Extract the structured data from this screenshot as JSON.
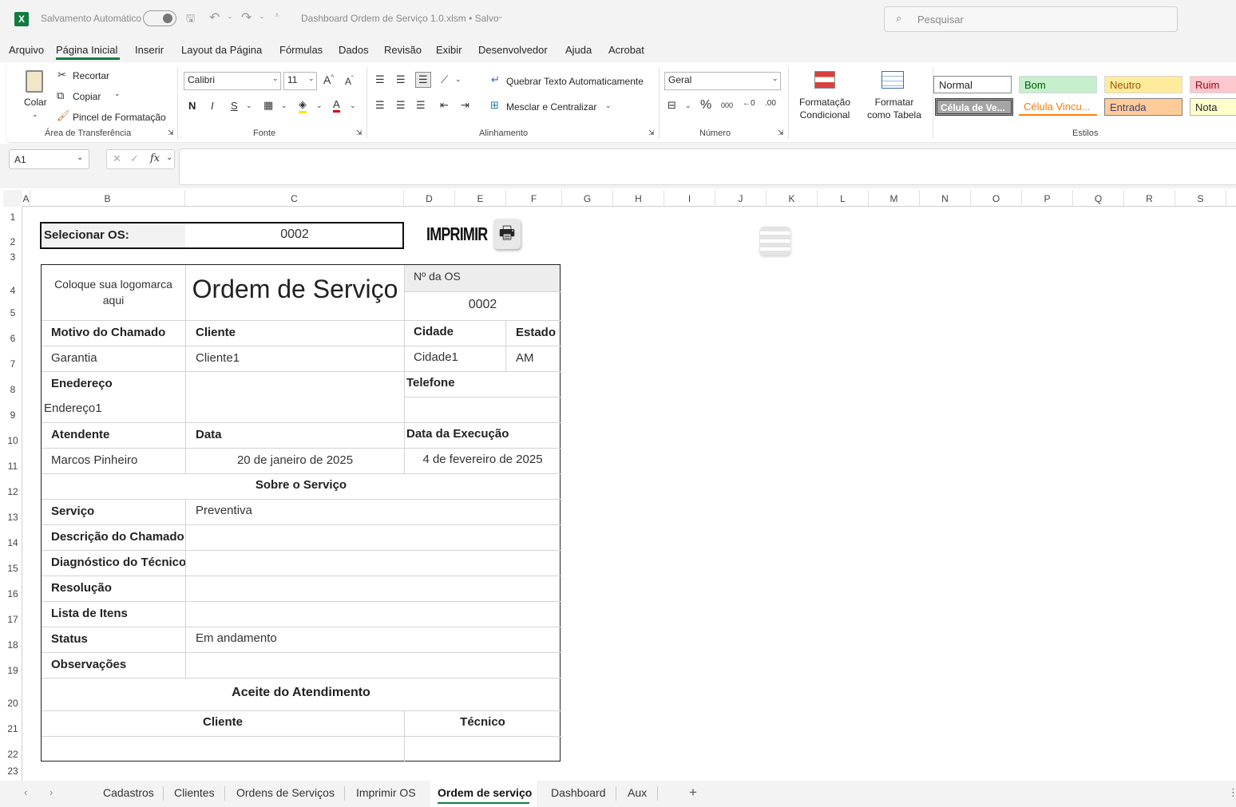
{
  "titlebar": {
    "autosave": "Salvamento Automático",
    "toggle": "Desativado",
    "filename": "Dashboard Ordem de Serviço 1.0.xlsm • Salvo",
    "search_placeholder": "Pesquisar"
  },
  "menu": [
    "Arquivo",
    "Página Inicial",
    "Inserir",
    "Layout da Página",
    "Fórmulas",
    "Dados",
    "Revisão",
    "Exibir",
    "Desenvolvedor",
    "Ajuda",
    "Acrobat"
  ],
  "ribbon": {
    "clipboard": {
      "paste": "Colar",
      "cut": "Recortar",
      "copy": "Copiar",
      "format_painter": "Pincel de Formatação",
      "group": "Área de Transferência"
    },
    "font": {
      "name": "Calibri",
      "size": "11",
      "bold": "N",
      "italic": "I",
      "underline": "S",
      "group": "Fonte"
    },
    "alignment": {
      "wrap": "Quebrar Texto Automaticamente",
      "merge": "Mesclar e Centralizar",
      "group": "Alinhamento"
    },
    "number": {
      "format": "Geral",
      "group": "Número"
    },
    "conditional": "Formatação Condicional",
    "format_table": "Formatar como Tabela",
    "styles": {
      "group": "Estilos",
      "normal": "Normal",
      "bom": "Bom",
      "neutro": "Neutro",
      "ruim": "Ruim",
      "celula_ver": "Célula de Ve...",
      "celula_vinc": "Célula Vincu...",
      "entrada": "Entrada",
      "nota": "Nota"
    }
  },
  "formula": {
    "namebox": "A1",
    "fx": "fx",
    "value": ""
  },
  "columns": [
    "A",
    "B",
    "C",
    "D",
    "E",
    "F",
    "G",
    "H",
    "I",
    "J",
    "K",
    "L",
    "M",
    "N",
    "O",
    "P",
    "Q",
    "R",
    "S"
  ],
  "rows": [
    "1",
    "2",
    "3",
    "4",
    "5",
    "6",
    "7",
    "8",
    "9",
    "10",
    "11",
    "12",
    "13",
    "14",
    "15",
    "16",
    "17",
    "18",
    "19",
    "20",
    "21",
    "22",
    "23"
  ],
  "form": {
    "selecionar_label": "Selecionar OS:",
    "selecionar_value": "0002",
    "imprimir": "IMPRIMIR",
    "logo": "Coloque sua logomarca aqui",
    "title": "Ordem de Serviço",
    "nos_label": "Nº da OS",
    "nos_value": "0002",
    "motivo_label": "Motivo do Chamado",
    "motivo_value": "Garantia",
    "cliente_label": "Cliente",
    "cliente_value": "Cliente1",
    "cidade_label": "Cidade",
    "cidade_value": "Cidade1",
    "estado_label": "Estado",
    "estado_value": "AM",
    "endereco_label": "Enedereço",
    "endereco_value": "Endereço1",
    "telefone_label": "Telefone",
    "atendente_label": "Atendente",
    "atendente_value": "Marcos Pinheiro",
    "data_label": "Data",
    "data_value": "20 de janeiro de 2025",
    "exec_label": "Data da Execução",
    "exec_value": "4 de fevereiro de 2025",
    "sobre": "Sobre o Serviço",
    "servico_label": "Serviço",
    "servico_value": "Preventiva",
    "descricao_label": "Descrição do Chamado",
    "diagnostico_label": "Diagnóstico do Técnico",
    "resolucao_label": "Resolução",
    "lista_label": "Lista de Itens",
    "status_label": "Status",
    "status_value": "Em andamento",
    "obs_label": "Observações",
    "aceite": "Aceite do Atendimento",
    "cliente_sig": "Cliente",
    "tecnico_sig": "Técnico"
  },
  "sheets": [
    "Cadastros",
    "Clientes",
    "Ordens de Serviços",
    "Imprimir OS",
    "Ordem de serviço",
    "Dashboard",
    "Aux"
  ],
  "active_sheet": "Ordem de serviço"
}
